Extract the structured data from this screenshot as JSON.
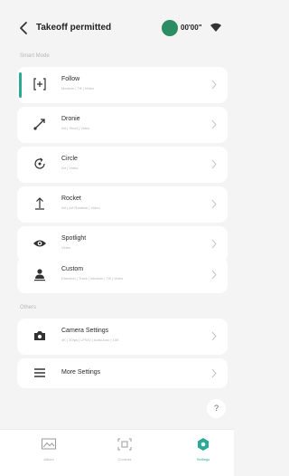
{
  "header": {
    "title": "Takeoff permitted",
    "gps_time": "00'00\""
  },
  "sections": {
    "smart_mode": "Smart Mode",
    "others": "Others"
  },
  "modes": [
    {
      "name": "Follow",
      "desc": "Medium | Tilt | Video"
    },
    {
      "name": "Dronie",
      "desc": "Art | Short | Video"
    },
    {
      "name": "Circle",
      "desc": "Art | Video"
    },
    {
      "name": "Rocket",
      "desc": "Art | Art Rotation | Video"
    },
    {
      "name": "Spotlight",
      "desc": "Video"
    },
    {
      "name": "Custom",
      "desc": "Direction | Track | Medium | Tilt | Video"
    }
  ],
  "others": [
    {
      "name": "Camera Settings",
      "desc": "4K | 30fps | LPWU | Auto/Auto | 10E"
    },
    {
      "name": "More Settings",
      "desc": ""
    }
  ],
  "help_label": "?",
  "tabs": [
    {
      "label": "Album"
    },
    {
      "label": "Controls"
    },
    {
      "label": "Settings"
    }
  ],
  "colors": {
    "accent": "#2aaa95",
    "gps": "#2c8c64"
  }
}
